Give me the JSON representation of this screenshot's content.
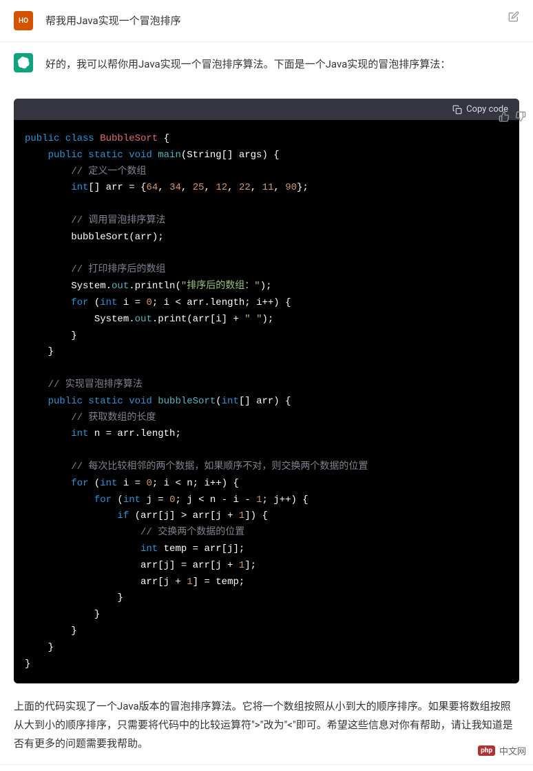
{
  "user": {
    "avatar_text": "HO",
    "message": "帮我用Java实现一个冒泡排序"
  },
  "assistant": {
    "intro": "好的，我可以帮你用Java实现一个冒泡排序算法。下面是一个Java实现的冒泡排序算法：",
    "copy_label": "Copy code",
    "code": {
      "l1_class": "public class ",
      "l1_name": "BubbleSort",
      "l1_brace": " {",
      "l2_mods": "    public static void ",
      "l2_fn": "main",
      "l2_args": "(String[] args) {",
      "l3_com": "        // 定义一个数组",
      "l4_type": "        int",
      "l4_mid1": "[] arr = {",
      "l4_n1": "64",
      "l4_c1": ", ",
      "l4_n2": "34",
      "l4_c2": ", ",
      "l4_n3": "25",
      "l4_c3": ", ",
      "l4_n4": "12",
      "l4_c4": ", ",
      "l4_n5": "22",
      "l4_c5": ", ",
      "l4_n6": "11",
      "l4_c6": ", ",
      "l4_n7": "90",
      "l4_end": "};",
      "l5": "",
      "l6_com": "        // 调用冒泡排序算法",
      "l7": "        bubbleSort(arr);",
      "l8": "",
      "l9_com": "        // 打印排序后的数组",
      "l10_a": "        System.",
      "l10_out": "out",
      "l10_b": ".println(",
      "l10_str": "\"排序后的数组：\"",
      "l10_c": ");",
      "l11_for": "        for ",
      "l11_a": "(",
      "l11_int": "int",
      "l11_b": " i = ",
      "l11_zero": "0",
      "l11_c": "; i < arr.length; i++) {",
      "l12_a": "            System.",
      "l12_out": "out",
      "l12_b": ".print(arr[i] + ",
      "l12_str": "\" \"",
      "l12_c": ");",
      "l13": "        }",
      "l14": "    }",
      "l15": "",
      "l16_com": "    // 实现冒泡排序算法",
      "l17_mods": "    public static void ",
      "l17_fn": "bubbleSort",
      "l17_a": "(",
      "l17_int": "int",
      "l17_b": "[] arr) {",
      "l18_com": "        // 获取数组的长度",
      "l19_int": "        int",
      "l19_rest": " n = arr.length;",
      "l20": "",
      "l21_com": "        // 每次比较相邻的两个数据，如果顺序不对，则交换两个数据的位置",
      "l22_for": "        for ",
      "l22_a": "(",
      "l22_int": "int",
      "l22_b": " i = ",
      "l22_zero": "0",
      "l22_c": "; i < n; i++) {",
      "l23_for": "            for ",
      "l23_a": "(",
      "l23_int": "int",
      "l23_b": " j = ",
      "l23_zero": "0",
      "l23_c": "; j < n - i - ",
      "l23_one": "1",
      "l23_d": "; j++) {",
      "l24_if": "                if ",
      "l24_a": "(arr[j] > arr[j + ",
      "l24_one": "1",
      "l24_b": "]) {",
      "l25_com": "                    // 交换两个数据的位置",
      "l26_int": "                    int",
      "l26_rest": " temp = arr[j];",
      "l27_a": "                    arr[j] = arr[j + ",
      "l27_one": "1",
      "l27_b": "];",
      "l28_a": "                    arr[j + ",
      "l28_one": "1",
      "l28_b": "] = temp;",
      "l29": "                }",
      "l30": "            }",
      "l31": "        }",
      "l32": "    }",
      "l33": "}"
    },
    "conclusion": "上面的代码实现了一个Java版本的冒泡排序算法。它将一个数组按照从小到大的顺序排序。如果要将数组按照从大到小的顺序排序，只需要将代码中的比较运算符\">\"改为\"<\"即可。希望这些信息对你有帮助，请让我知道是否有更多的问题需要我帮助。"
  },
  "watermark": {
    "badge": "php",
    "text": "中文网"
  }
}
